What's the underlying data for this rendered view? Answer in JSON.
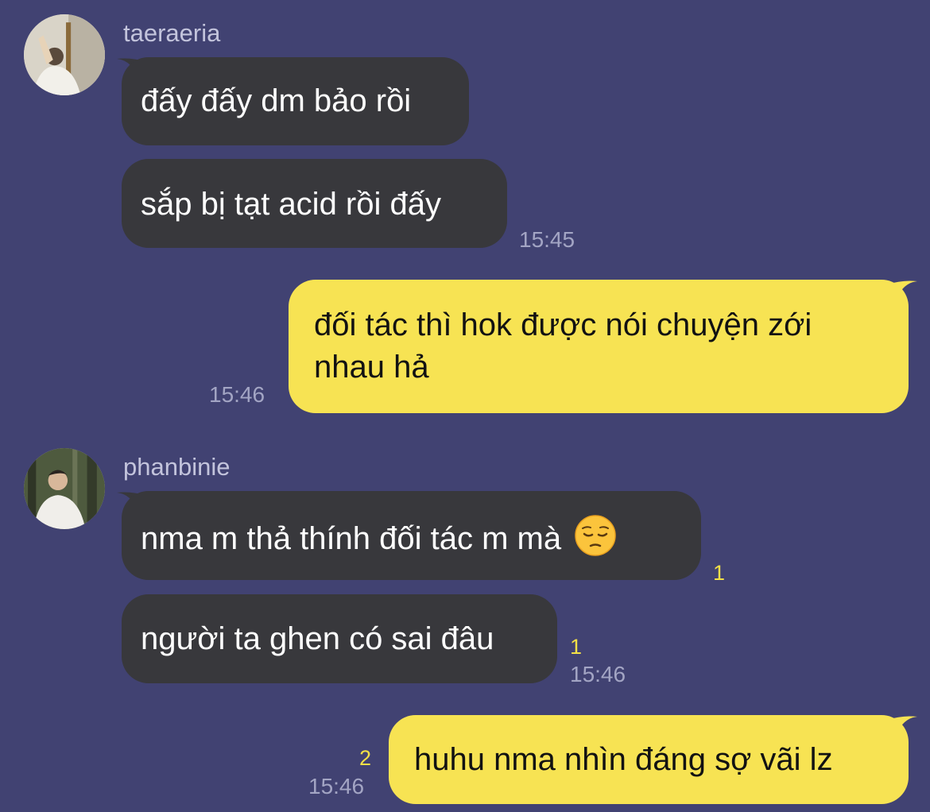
{
  "messages": [
    {
      "sender": "taeraeria",
      "bubbles": [
        "đấy đấy dm bảo rồi",
        "sắp bị tạt acid rồi đấy"
      ],
      "time": "15:45",
      "avatar_icon": "profile-photo-person-mirror-selfie"
    },
    {
      "bubbles": [
        "đối tác thì hok được nói chuyện zới",
        "nhau hả"
      ],
      "time": "15:46"
    },
    {
      "sender": "phanbinie",
      "bubbles": [
        "nma m thả thính đối tác m mà",
        "người ta ghen có sai đâu"
      ],
      "emoji": "pensive-face-emoji",
      "read_counts": [
        "1",
        "1"
      ],
      "time": "15:46",
      "avatar_icon": "profile-photo-person-forest"
    },
    {
      "bubbles": [
        "huhu nma nhìn đáng sợ vãi lz"
      ],
      "read_count": "2",
      "time": "15:46"
    }
  ],
  "colors": {
    "background": "#414272",
    "incoming_bubble": "#38383c",
    "outgoing_bubble": "#f7e353",
    "read_count": "#f2e047",
    "timestamp": "#a3a5c4"
  }
}
